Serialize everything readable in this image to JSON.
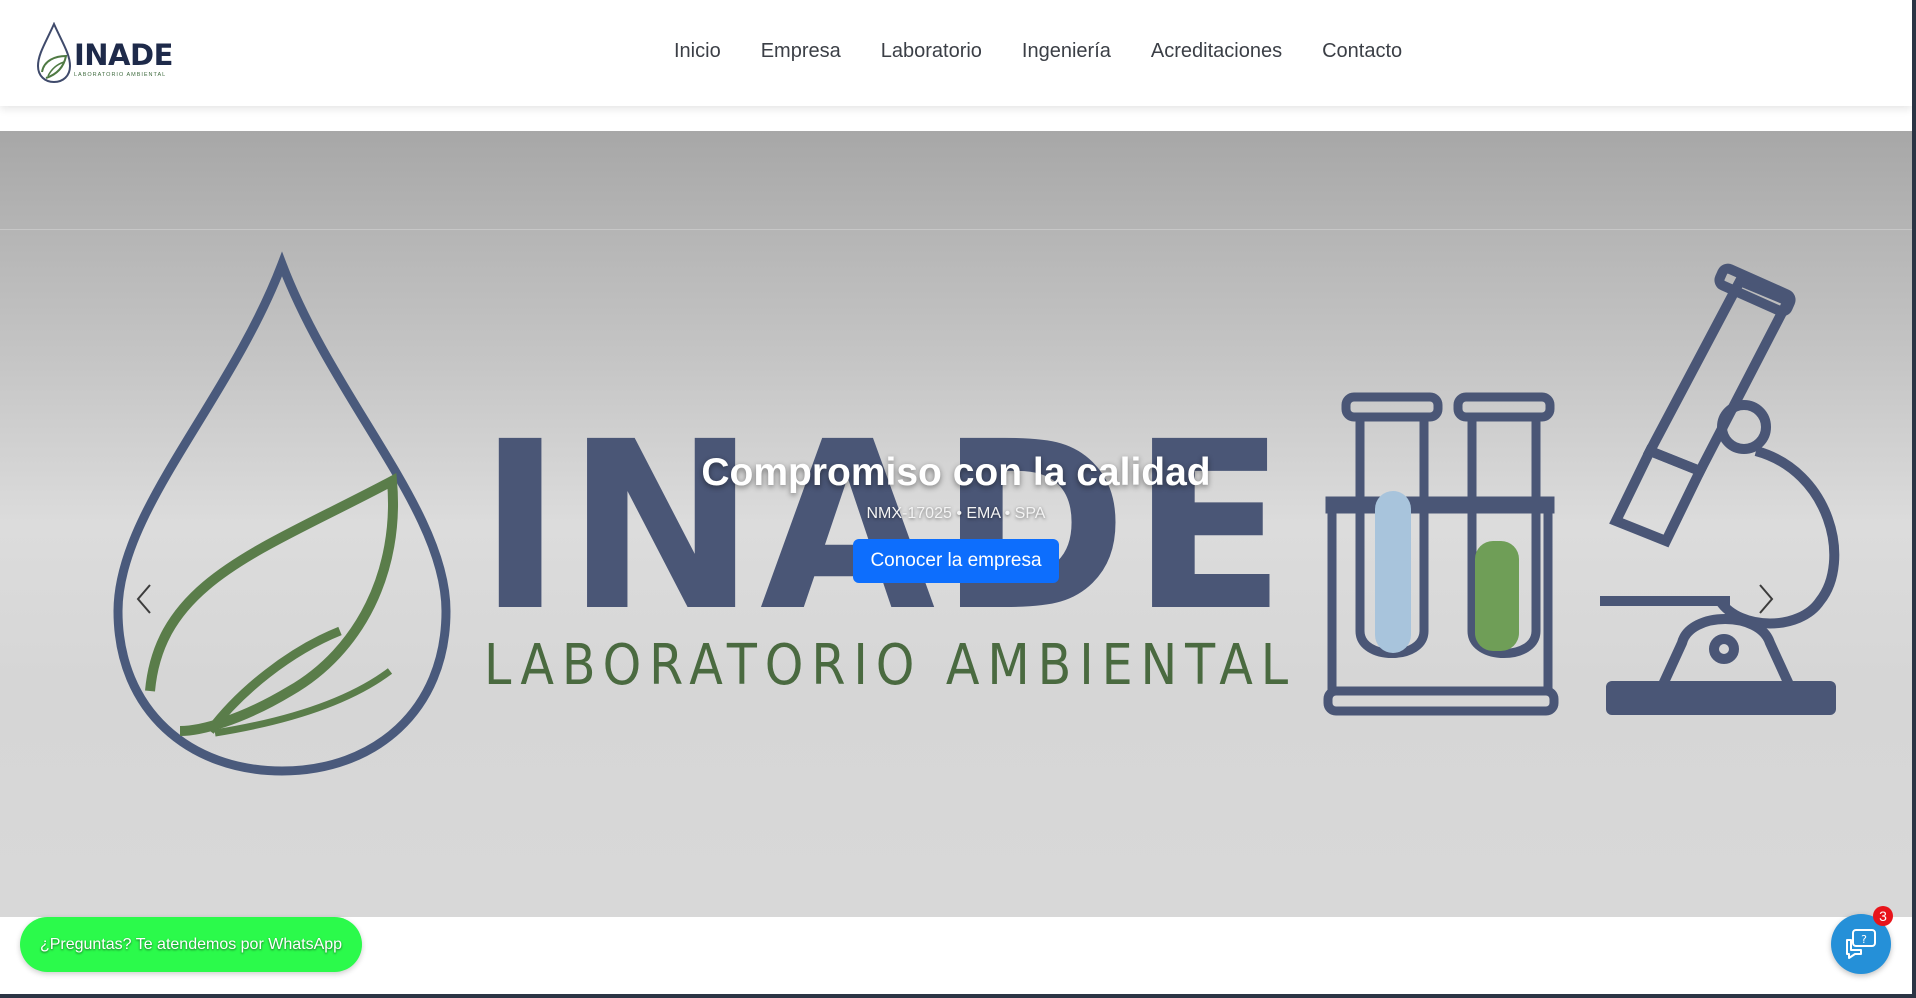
{
  "brand": {
    "name": "INADE",
    "subtitle": "LABORATORIO AMBIENTAL"
  },
  "nav": {
    "items": [
      "Inicio",
      "Empresa",
      "Laboratorio",
      "Ingeniería",
      "Acreditaciones",
      "Contacto"
    ]
  },
  "hero": {
    "logo_title": "INADE",
    "logo_subtitle": "LABORATORIO AMBIENTAL",
    "caption_title": "Compromiso con la calidad",
    "caption_subtitle": "NMX-17025 • EMA • SPA",
    "cta_label": "Conocer la empresa",
    "prev_icon": "chevron-left-icon",
    "next_icon": "chevron-right-icon"
  },
  "widgets": {
    "whatsapp_label": "¿Preguntas? Te atendemos por WhatsApp",
    "help_icon": "chat-question-icon",
    "help_badge": "3"
  },
  "colors": {
    "primary": "#0d6efd",
    "whatsapp": "#2bfa4b",
    "help": "#2590d8",
    "logo_navy": "#3f4a6b",
    "logo_green": "#5a7d4a"
  }
}
